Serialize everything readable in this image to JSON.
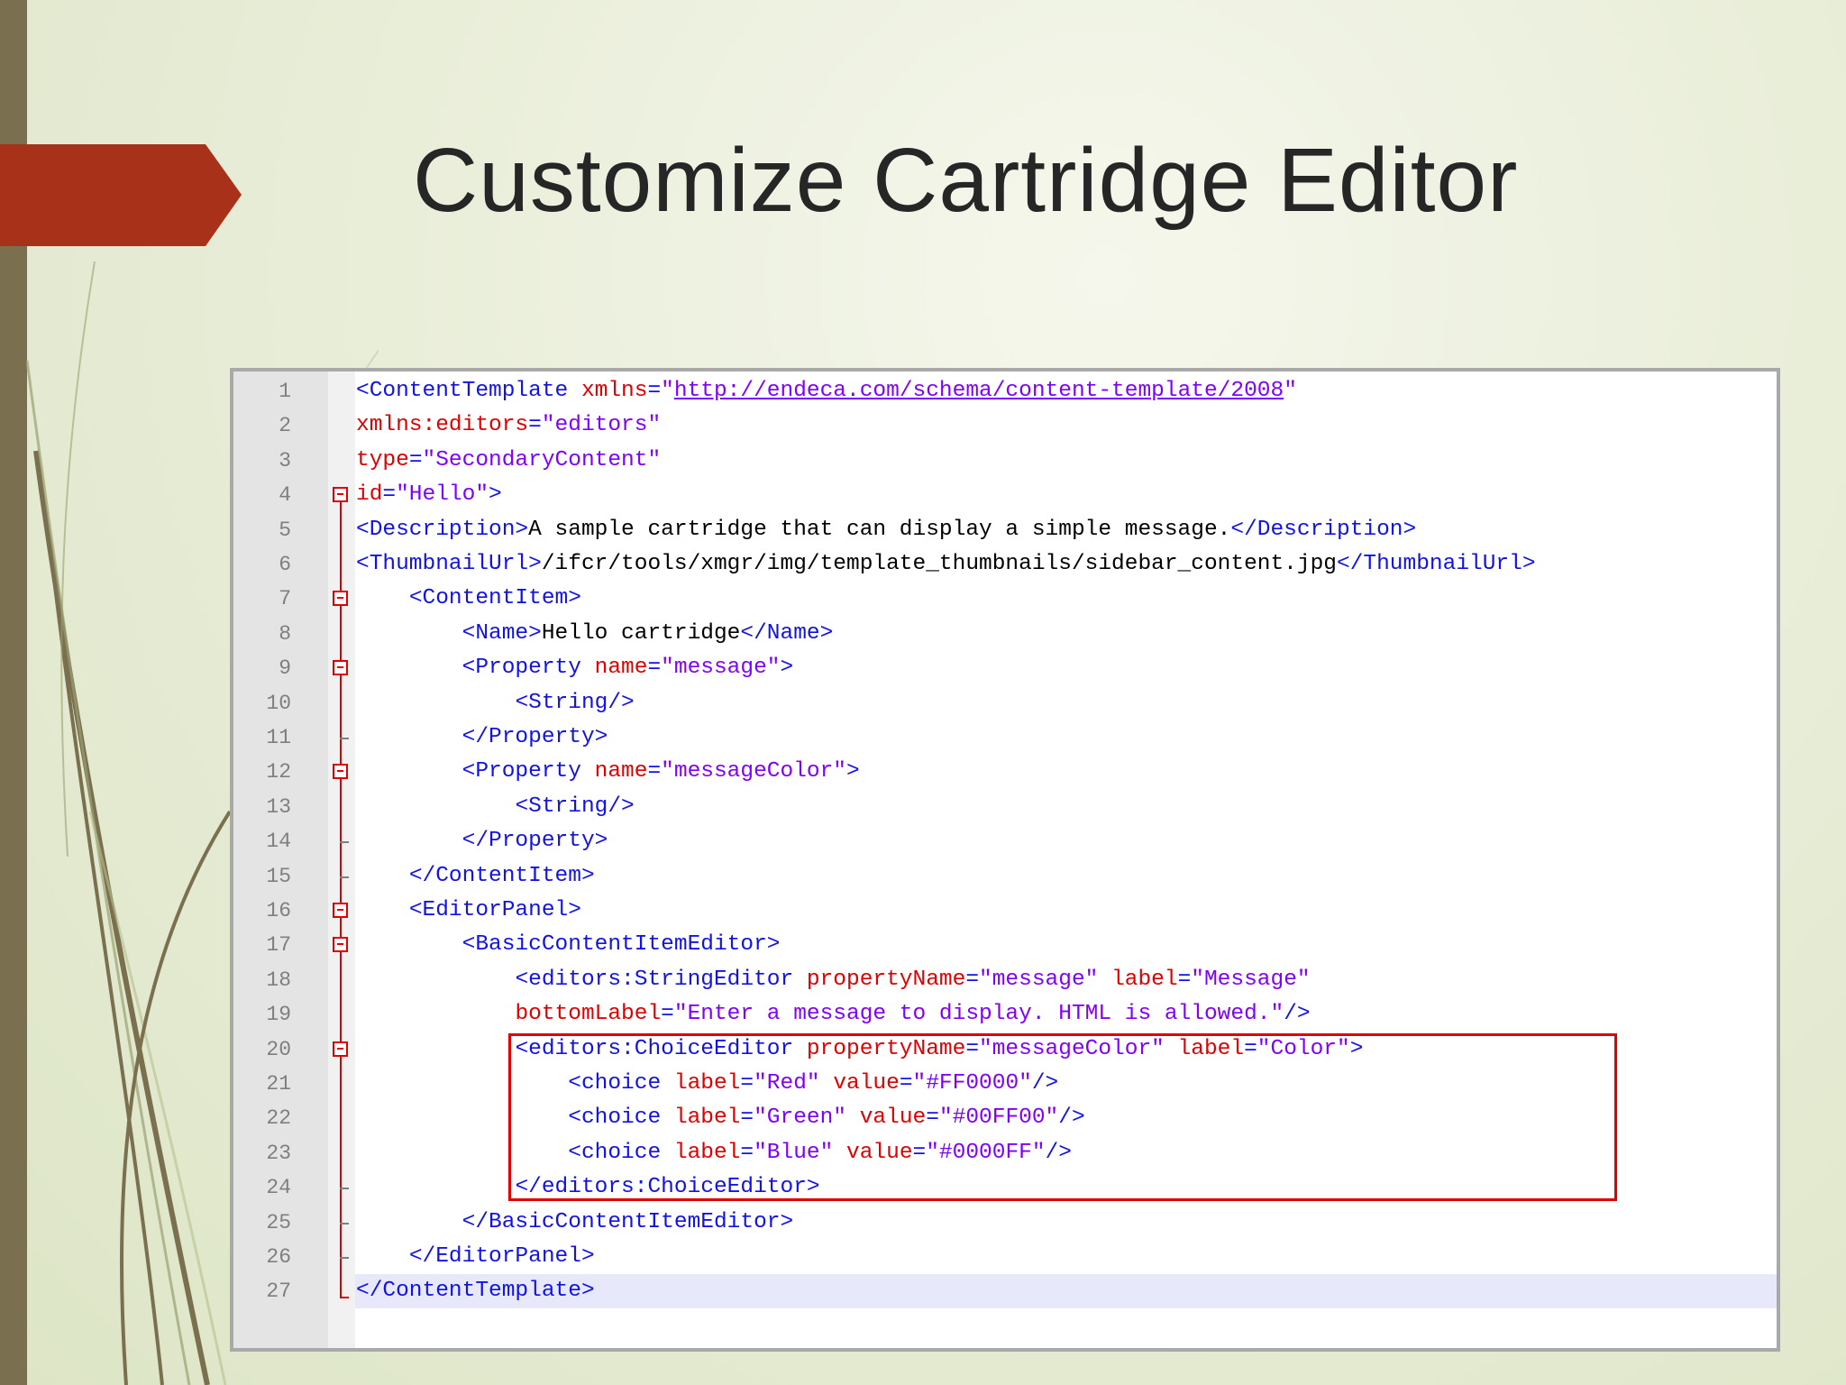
{
  "slide": {
    "title": "Customize Cartridge Editor",
    "accent_color": "#a8311a",
    "bar_color": "#7a7050"
  },
  "editor": {
    "line_numbers": [
      "1",
      "2",
      "3",
      "4",
      "5",
      "6",
      "7",
      "8",
      "9",
      "10",
      "11",
      "12",
      "13",
      "14",
      "15",
      "16",
      "17",
      "18",
      "19",
      "20",
      "21",
      "22",
      "23",
      "24",
      "25",
      "26",
      "27"
    ],
    "current_line": 27,
    "highlighted_lines": "20-24",
    "lines": [
      [
        {
          "t": "tag",
          "v": "<ContentTemplate "
        },
        {
          "t": "attr",
          "v": "xmlns"
        },
        {
          "t": "tag",
          "v": "="
        },
        {
          "t": "val",
          "v": "\""
        },
        {
          "t": "url",
          "v": "http://endeca.com/schema/content-template/2008"
        },
        {
          "t": "val",
          "v": "\""
        }
      ],
      [
        {
          "t": "attr",
          "v": "xmlns:editors"
        },
        {
          "t": "tag",
          "v": "="
        },
        {
          "t": "val",
          "v": "\"editors\""
        }
      ],
      [
        {
          "t": "attr",
          "v": "type"
        },
        {
          "t": "tag",
          "v": "="
        },
        {
          "t": "val",
          "v": "\"SecondaryContent\""
        }
      ],
      [
        {
          "t": "attr",
          "v": "id"
        },
        {
          "t": "tag",
          "v": "="
        },
        {
          "t": "val",
          "v": "\"Hello\""
        },
        {
          "t": "tag",
          "v": ">"
        }
      ],
      [
        {
          "t": "tag",
          "v": "<Description>"
        },
        {
          "t": "text",
          "v": "A sample cartridge that can display a simple message."
        },
        {
          "t": "tag",
          "v": "</Description>"
        }
      ],
      [
        {
          "t": "tag",
          "v": "<ThumbnailUrl>"
        },
        {
          "t": "text",
          "v": "/ifcr/tools/xmgr/img/template_thumbnails/sidebar_content.jpg"
        },
        {
          "t": "tag",
          "v": "</ThumbnailUrl>"
        }
      ],
      [
        {
          "t": "text",
          "v": "    "
        },
        {
          "t": "tag",
          "v": "<ContentItem>"
        }
      ],
      [
        {
          "t": "text",
          "v": "        "
        },
        {
          "t": "tag",
          "v": "<Name>"
        },
        {
          "t": "text",
          "v": "Hello cartridge"
        },
        {
          "t": "tag",
          "v": "</Name>"
        }
      ],
      [
        {
          "t": "text",
          "v": "        "
        },
        {
          "t": "tag",
          "v": "<Property "
        },
        {
          "t": "attr",
          "v": "name"
        },
        {
          "t": "tag",
          "v": "="
        },
        {
          "t": "val",
          "v": "\"message\""
        },
        {
          "t": "tag",
          "v": ">"
        }
      ],
      [
        {
          "t": "text",
          "v": "            "
        },
        {
          "t": "tag",
          "v": "<String/>"
        }
      ],
      [
        {
          "t": "text",
          "v": "        "
        },
        {
          "t": "tag",
          "v": "</Property>"
        }
      ],
      [
        {
          "t": "text",
          "v": "        "
        },
        {
          "t": "tag",
          "v": "<Property "
        },
        {
          "t": "attr",
          "v": "name"
        },
        {
          "t": "tag",
          "v": "="
        },
        {
          "t": "val",
          "v": "\"messageColor\""
        },
        {
          "t": "tag",
          "v": ">"
        }
      ],
      [
        {
          "t": "text",
          "v": "            "
        },
        {
          "t": "tag",
          "v": "<String/>"
        }
      ],
      [
        {
          "t": "text",
          "v": "        "
        },
        {
          "t": "tag",
          "v": "</Property>"
        }
      ],
      [
        {
          "t": "text",
          "v": "    "
        },
        {
          "t": "tag",
          "v": "</ContentItem>"
        }
      ],
      [
        {
          "t": "text",
          "v": "    "
        },
        {
          "t": "tag",
          "v": "<EditorPanel>"
        }
      ],
      [
        {
          "t": "text",
          "v": "        "
        },
        {
          "t": "tag",
          "v": "<BasicContentItemEditor>"
        }
      ],
      [
        {
          "t": "text",
          "v": "            "
        },
        {
          "t": "tag",
          "v": "<editors:StringEditor "
        },
        {
          "t": "attr",
          "v": "propertyName"
        },
        {
          "t": "tag",
          "v": "="
        },
        {
          "t": "val",
          "v": "\"message\""
        },
        {
          "t": "text",
          "v": " "
        },
        {
          "t": "attr",
          "v": "label"
        },
        {
          "t": "tag",
          "v": "="
        },
        {
          "t": "val",
          "v": "\"Message\""
        }
      ],
      [
        {
          "t": "text",
          "v": "            "
        },
        {
          "t": "attr",
          "v": "bottomLabel"
        },
        {
          "t": "tag",
          "v": "="
        },
        {
          "t": "val",
          "v": "\"Enter a message to display. HTML is allowed.\""
        },
        {
          "t": "tag",
          "v": "/>"
        }
      ],
      [
        {
          "t": "text",
          "v": "            "
        },
        {
          "t": "tag",
          "v": "<editors:ChoiceEditor "
        },
        {
          "t": "attr",
          "v": "propertyName"
        },
        {
          "t": "tag",
          "v": "="
        },
        {
          "t": "val",
          "v": "\"messageColor\""
        },
        {
          "t": "text",
          "v": " "
        },
        {
          "t": "attr",
          "v": "label"
        },
        {
          "t": "tag",
          "v": "="
        },
        {
          "t": "val",
          "v": "\"Color\""
        },
        {
          "t": "tag",
          "v": ">"
        }
      ],
      [
        {
          "t": "text",
          "v": "                "
        },
        {
          "t": "tag",
          "v": "<choice "
        },
        {
          "t": "attr",
          "v": "label"
        },
        {
          "t": "tag",
          "v": "="
        },
        {
          "t": "val",
          "v": "\"Red\""
        },
        {
          "t": "text",
          "v": " "
        },
        {
          "t": "attr",
          "v": "value"
        },
        {
          "t": "tag",
          "v": "="
        },
        {
          "t": "val",
          "v": "\"#FF0000\""
        },
        {
          "t": "tag",
          "v": "/>"
        }
      ],
      [
        {
          "t": "text",
          "v": "                "
        },
        {
          "t": "tag",
          "v": "<choice "
        },
        {
          "t": "attr",
          "v": "label"
        },
        {
          "t": "tag",
          "v": "="
        },
        {
          "t": "val",
          "v": "\"Green\""
        },
        {
          "t": "text",
          "v": " "
        },
        {
          "t": "attr",
          "v": "value"
        },
        {
          "t": "tag",
          "v": "="
        },
        {
          "t": "val",
          "v": "\"#00FF00\""
        },
        {
          "t": "tag",
          "v": "/>"
        }
      ],
      [
        {
          "t": "text",
          "v": "                "
        },
        {
          "t": "tag",
          "v": "<choice "
        },
        {
          "t": "attr",
          "v": "label"
        },
        {
          "t": "tag",
          "v": "="
        },
        {
          "t": "val",
          "v": "\"Blue\""
        },
        {
          "t": "text",
          "v": " "
        },
        {
          "t": "attr",
          "v": "value"
        },
        {
          "t": "tag",
          "v": "="
        },
        {
          "t": "val",
          "v": "\"#0000FF\""
        },
        {
          "t": "tag",
          "v": "/>"
        }
      ],
      [
        {
          "t": "text",
          "v": "            "
        },
        {
          "t": "tag",
          "v": "</editors:ChoiceEditor>"
        }
      ],
      [
        {
          "t": "text",
          "v": "        "
        },
        {
          "t": "tag",
          "v": "</BasicContentItemEditor>"
        }
      ],
      [
        {
          "t": "text",
          "v": "    "
        },
        {
          "t": "tag",
          "v": "</EditorPanel>"
        }
      ],
      [
        {
          "t": "tag",
          "v": "</ContentTemplate>"
        }
      ]
    ],
    "syntax_colors": {
      "tag": "#1212e8",
      "attr": "#e00000",
      "value": "#8000ff",
      "text": "#000000",
      "fold_marker": "#e00000"
    }
  }
}
